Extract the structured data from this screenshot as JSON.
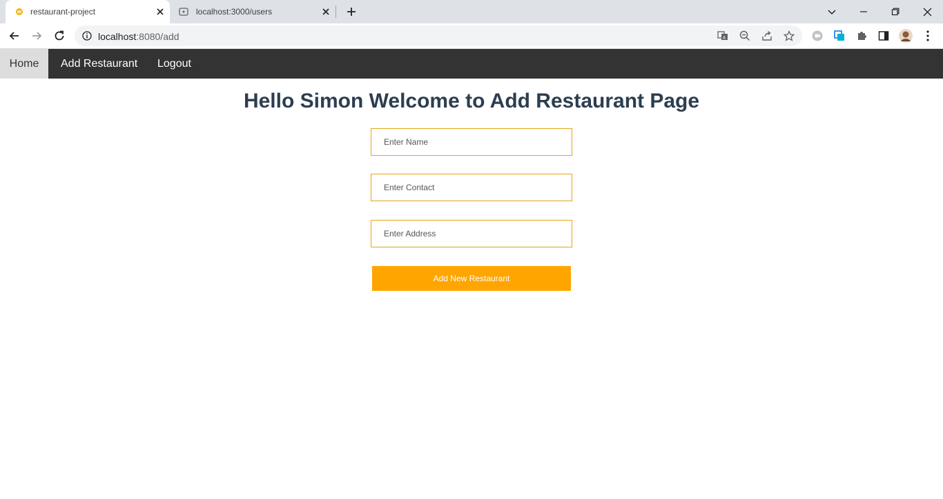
{
  "browser": {
    "tabs": [
      {
        "title": "restaurant-project",
        "active": true,
        "favicon": "vue-favicon-icon"
      },
      {
        "title": "localhost:3000/users",
        "active": false,
        "favicon": "globe-favicon-icon"
      }
    ],
    "address": {
      "host": "localhost",
      "path": ":8080/add"
    }
  },
  "nav": {
    "home": "Home",
    "add_restaurant": "Add Restaurant",
    "logout": "Logout"
  },
  "page": {
    "title": "Hello Simon Welcome to Add Restaurant Page"
  },
  "form": {
    "name_placeholder": "Enter Name",
    "contact_placeholder": "Enter Contact",
    "address_placeholder": "Enter Address",
    "submit_label": "Add New Restaurant"
  },
  "colors": {
    "navbar": "#333333",
    "home_active": "#dddddd",
    "title": "#2c3e50",
    "field_border": "#e6a317",
    "button": "#ffa500"
  }
}
